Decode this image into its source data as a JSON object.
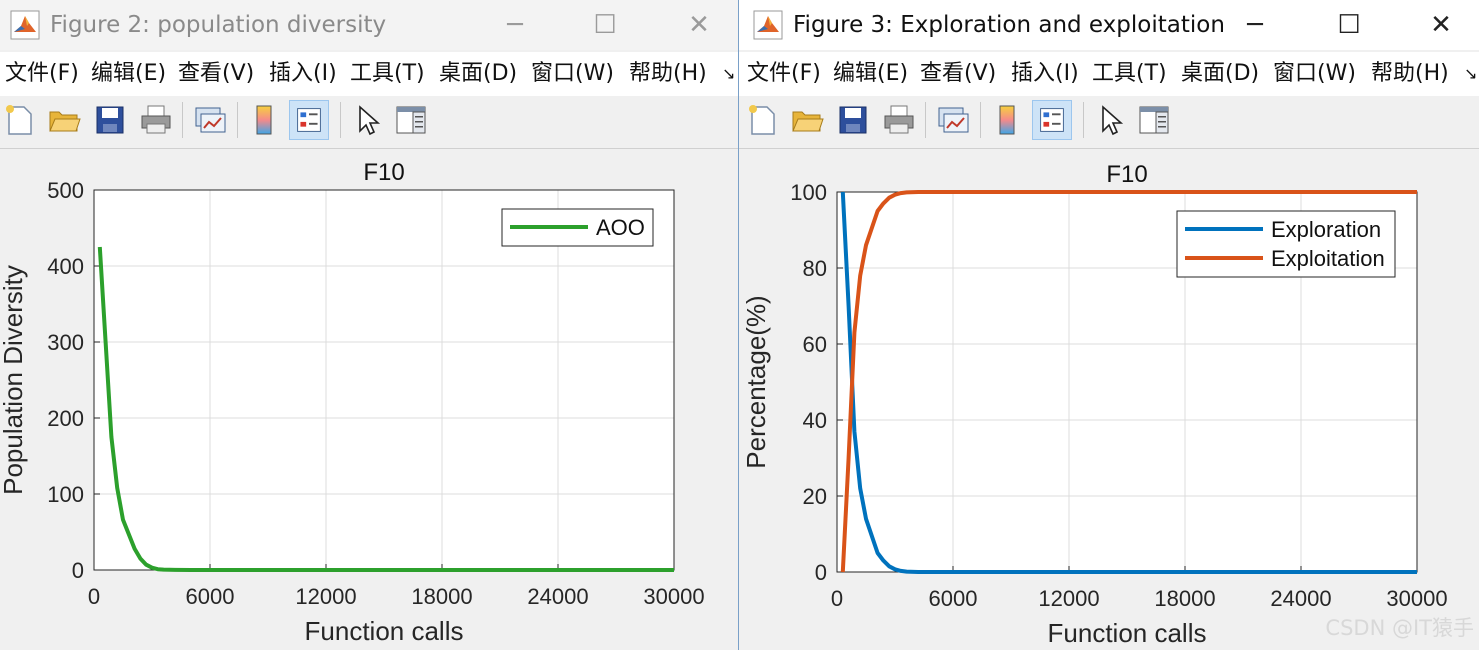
{
  "windows": [
    {
      "title": "Figure 2: population diversity",
      "minimize_glyph": "─",
      "maximize_glyph": "☐",
      "close_glyph": "✕",
      "menu": [
        "文件(F)",
        "编辑(E)",
        "查看(V)",
        "插入(I)",
        "工具(T)",
        "桌面(D)",
        "窗口(W)",
        "帮助(H)"
      ],
      "menu_overflow": "↘",
      "toolbar_icons": [
        "new-figure-icon",
        "open-file-icon",
        "save-icon",
        "print-icon",
        "link-plot-icon",
        "colorbar-icon",
        "legend-icon",
        "pointer-icon",
        "property-inspector-icon"
      ]
    },
    {
      "title": "Figure 3: Exploration and exploitation",
      "minimize_glyph": "─",
      "maximize_glyph": "☐",
      "close_glyph": "✕",
      "menu": [
        "文件(F)",
        "编辑(E)",
        "查看(V)",
        "插入(I)",
        "工具(T)",
        "桌面(D)",
        "窗口(W)",
        "帮助(H)"
      ],
      "menu_overflow": "↘",
      "toolbar_icons": [
        "new-figure-icon",
        "open-file-icon",
        "save-icon",
        "print-icon",
        "link-plot-icon",
        "colorbar-icon",
        "legend-icon",
        "pointer-icon",
        "property-inspector-icon"
      ]
    }
  ],
  "watermark": "CSDN @IT猿手",
  "chart_data": [
    {
      "type": "line",
      "title": "F10",
      "xlabel": "Function calls",
      "ylabel": "Population Diversity",
      "xlim": [
        0,
        30000
      ],
      "ylim": [
        0,
        500
      ],
      "xticks": [
        "0",
        "6000",
        "12000",
        "18000",
        "24000",
        "30000"
      ],
      "yticks": [
        "0",
        "100",
        "200",
        "300",
        "400",
        "500"
      ],
      "grid": true,
      "legend_position": "top-right",
      "series": [
        {
          "name": "AOO",
          "color": "#2ca02c",
          "x": [
            300,
            600,
            900,
            1200,
            1500,
            2100,
            2400,
            2700,
            3000,
            3300,
            3600,
            4200,
            5000,
            6000,
            9000,
            12000,
            18000,
            24000,
            30000
          ],
          "y": [
            425,
            300,
            175,
            108,
            66,
            28,
            15,
            7,
            3,
            1,
            0.5,
            0.1,
            0,
            0,
            0,
            0,
            0,
            0,
            0
          ]
        }
      ]
    },
    {
      "type": "line",
      "title": "F10",
      "xlabel": "Function calls",
      "ylabel": "Percentage(%)",
      "xlim": [
        0,
        30000
      ],
      "ylim": [
        0,
        100
      ],
      "xticks": [
        "0",
        "6000",
        "12000",
        "18000",
        "24000",
        "30000"
      ],
      "yticks": [
        "0",
        "20",
        "40",
        "60",
        "80",
        "100"
      ],
      "grid": true,
      "legend_position": "top-right",
      "series": [
        {
          "name": "Exploration",
          "color": "#0072bd",
          "x": [
            300,
            600,
            900,
            1200,
            1500,
            2100,
            2400,
            2700,
            3000,
            3300,
            3600,
            4200,
            5000,
            6000,
            12000,
            18000,
            24000,
            30000
          ],
          "y": [
            100,
            70,
            37,
            22,
            14,
            5,
            3,
            1.5,
            0.7,
            0.3,
            0.1,
            0,
            0,
            0,
            0,
            0,
            0,
            0
          ]
        },
        {
          "name": "Exploitation",
          "color": "#d95319",
          "x": [
            300,
            600,
            900,
            1200,
            1500,
            2100,
            2400,
            2700,
            3000,
            3300,
            3600,
            4200,
            5000,
            6000,
            12000,
            18000,
            24000,
            30000
          ],
          "y": [
            0,
            30,
            63,
            78,
            86,
            95,
            97,
            98.5,
            99.3,
            99.7,
            99.9,
            100,
            100,
            100,
            100,
            100,
            100,
            100
          ]
        }
      ]
    }
  ]
}
